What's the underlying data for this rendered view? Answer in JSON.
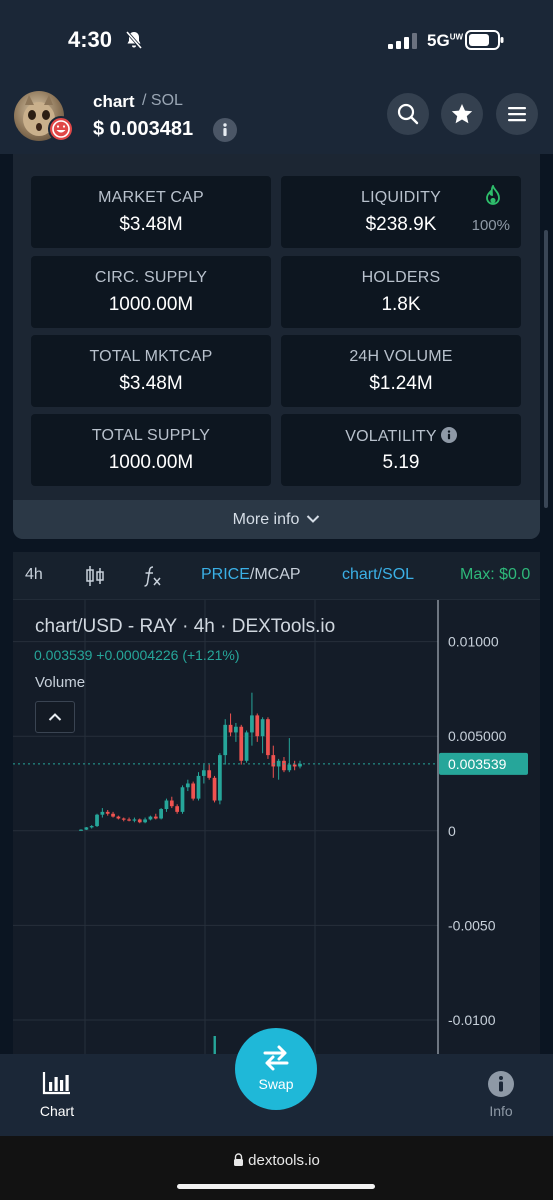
{
  "status_bar": {
    "time": "4:30",
    "network": "5G",
    "network_suffix": "UW"
  },
  "header": {
    "token_name": "chart",
    "pair": "/ SOL",
    "price": "$ 0.003481"
  },
  "stats": [
    {
      "label": "MARKET CAP",
      "value": "$3.48M"
    },
    {
      "label": "LIQUIDITY",
      "value": "$238.9K",
      "extra": "100%"
    },
    {
      "label": "CIRC. SUPPLY",
      "value": "1000.00M"
    },
    {
      "label": "HOLDERS",
      "value": "1.8K"
    },
    {
      "label": "TOTAL MKTCAP",
      "value": "$3.48M"
    },
    {
      "label": "24H VOLUME",
      "value": "$1.24M"
    },
    {
      "label": "TOTAL SUPPLY",
      "value": "1000.00M"
    },
    {
      "label": "VOLATILITY",
      "value": "5.19"
    }
  ],
  "more_info": "More info",
  "toolbar": {
    "interval": "4h",
    "price": "PRICE",
    "mcap": "/MCAP",
    "pair": "chart/SOL",
    "max": "Max: $0.0"
  },
  "chart": {
    "legend_title": "chart/USD - RAY · 4h · DEXTools.io",
    "legend_ohlc": "0.003539  +0.00004226 (+1.21%)",
    "volume_label": "Volume",
    "y_ticks": [
      "0.01000",
      "0.005000",
      "0",
      "-0.0050",
      "-0.0100"
    ],
    "last_price_label": "0.003539",
    "colors": {
      "up": "#26a69a",
      "down": "#ef5350",
      "accent": "#3bb0e6",
      "swap": "#1fb8d8"
    }
  },
  "chart_data": {
    "type": "candlestick",
    "title": "chart/USD - RAY · 4h · DEXTools.io",
    "ylim": [
      -0.0118,
      0.0122
    ],
    "y_ticks": [
      0.01,
      0.005,
      0,
      -0.005,
      -0.01
    ],
    "last_price": 0.003539,
    "candles": [
      {
        "o": 5e-05,
        "h": 8e-05,
        "l": 3e-05,
        "c": 6e-05
      },
      {
        "o": 6e-05,
        "h": 0.0002,
        "l": 4e-05,
        "c": 0.00018
      },
      {
        "o": 0.00018,
        "h": 0.0003,
        "l": 0.00012,
        "c": 0.00025
      },
      {
        "o": 0.00025,
        "h": 0.0009,
        "l": 0.0002,
        "c": 0.00085
      },
      {
        "o": 0.00085,
        "h": 0.0012,
        "l": 0.0007,
        "c": 0.001
      },
      {
        "o": 0.001,
        "h": 0.0011,
        "l": 0.0008,
        "c": 0.0009
      },
      {
        "o": 0.0009,
        "h": 0.001,
        "l": 0.0007,
        "c": 0.00075
      },
      {
        "o": 0.00075,
        "h": 0.0008,
        "l": 0.0006,
        "c": 0.00065
      },
      {
        "o": 0.00065,
        "h": 0.0007,
        "l": 0.0005,
        "c": 0.0006
      },
      {
        "o": 0.0006,
        "h": 0.0007,
        "l": 0.0005,
        "c": 0.00055
      },
      {
        "o": 0.00055,
        "h": 0.0007,
        "l": 0.00045,
        "c": 0.0006
      },
      {
        "o": 0.0006,
        "h": 0.00065,
        "l": 0.0004,
        "c": 0.00045
      },
      {
        "o": 0.00045,
        "h": 0.0007,
        "l": 0.0004,
        "c": 0.0006
      },
      {
        "o": 0.0006,
        "h": 0.0008,
        "l": 0.00055,
        "c": 0.00075
      },
      {
        "o": 0.00075,
        "h": 0.0009,
        "l": 0.0006,
        "c": 0.00065
      },
      {
        "o": 0.00065,
        "h": 0.0012,
        "l": 0.0006,
        "c": 0.00115
      },
      {
        "o": 0.00115,
        "h": 0.0017,
        "l": 0.001,
        "c": 0.0016
      },
      {
        "o": 0.0016,
        "h": 0.0018,
        "l": 0.0012,
        "c": 0.0013
      },
      {
        "o": 0.0013,
        "h": 0.0014,
        "l": 0.0009,
        "c": 0.001
      },
      {
        "o": 0.001,
        "h": 0.0024,
        "l": 0.0009,
        "c": 0.0023
      },
      {
        "o": 0.0023,
        "h": 0.0027,
        "l": 0.0021,
        "c": 0.0025
      },
      {
        "o": 0.0025,
        "h": 0.0026,
        "l": 0.0016,
        "c": 0.0017
      },
      {
        "o": 0.0017,
        "h": 0.0031,
        "l": 0.0016,
        "c": 0.0029
      },
      {
        "o": 0.0029,
        "h": 0.0035,
        "l": 0.0025,
        "c": 0.0032
      },
      {
        "o": 0.0032,
        "h": 0.0035,
        "l": 0.0027,
        "c": 0.0028
      },
      {
        "o": 0.0028,
        "h": 0.0029,
        "l": 0.0015,
        "c": 0.0016
      },
      {
        "o": 0.0016,
        "h": 0.0041,
        "l": 0.0014,
        "c": 0.004
      },
      {
        "o": 0.004,
        "h": 0.0059,
        "l": 0.0035,
        "c": 0.0056
      },
      {
        "o": 0.0056,
        "h": 0.0062,
        "l": 0.005,
        "c": 0.0052
      },
      {
        "o": 0.0052,
        "h": 0.0057,
        "l": 0.0047,
        "c": 0.0055
      },
      {
        "o": 0.0055,
        "h": 0.0056,
        "l": 0.0035,
        "c": 0.0037
      },
      {
        "o": 0.0037,
        "h": 0.0053,
        "l": 0.0036,
        "c": 0.0052
      },
      {
        "o": 0.0052,
        "h": 0.0073,
        "l": 0.0045,
        "c": 0.0061
      },
      {
        "o": 0.0061,
        "h": 0.0062,
        "l": 0.0047,
        "c": 0.005
      },
      {
        "o": 0.005,
        "h": 0.006,
        "l": 0.0041,
        "c": 0.0059
      },
      {
        "o": 0.0059,
        "h": 0.006,
        "l": 0.0038,
        "c": 0.004
      },
      {
        "o": 0.004,
        "h": 0.0045,
        "l": 0.0028,
        "c": 0.0034
      },
      {
        "o": 0.0034,
        "h": 0.0038,
        "l": 0.0027,
        "c": 0.0037
      },
      {
        "o": 0.0037,
        "h": 0.0039,
        "l": 0.0031,
        "c": 0.0032
      },
      {
        "o": 0.0032,
        "h": 0.0049,
        "l": 0.0031,
        "c": 0.0035
      },
      {
        "o": 0.0035,
        "h": 0.0037,
        "l": 0.0032,
        "c": 0.0034
      },
      {
        "o": 0.0034,
        "h": 0.0037,
        "l": 0.0033,
        "c": 0.003539
      }
    ]
  },
  "nav": {
    "chart_label": "Chart",
    "swap_label": "Swap",
    "info_label": "Info"
  },
  "browser": {
    "url": "dextools.io"
  }
}
